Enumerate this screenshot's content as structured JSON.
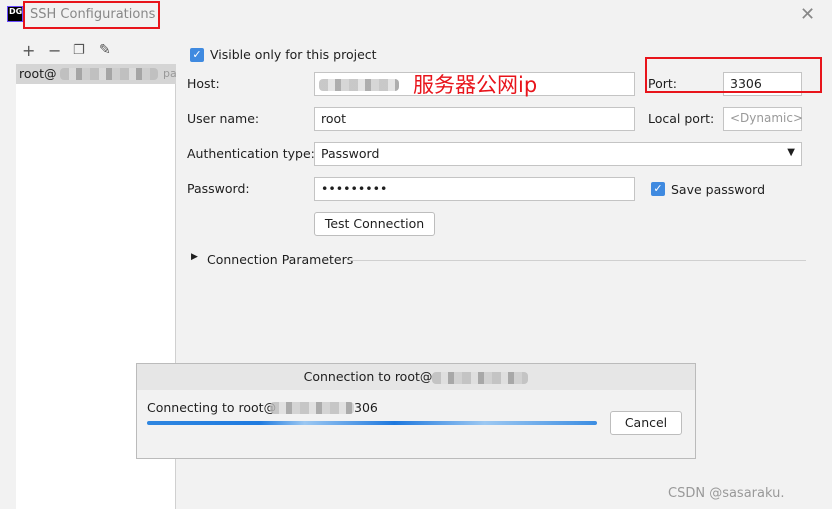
{
  "window": {
    "title": "SSH Configurations",
    "logo": "DG",
    "close_icon": "close-icon"
  },
  "sidebar": {
    "toolbar": [
      "add-icon",
      "remove-icon",
      "copy-icon",
      "edit-icon"
    ],
    "items": [
      {
        "label": "root@",
        "suffix": "pa"
      }
    ]
  },
  "form": {
    "visible_only": {
      "label": "Visible only for this project",
      "checked": true
    },
    "host": {
      "label": "Host:",
      "value": ""
    },
    "annotation": "服务器公网ip",
    "port": {
      "label": "Port:",
      "value": "3306"
    },
    "user": {
      "label": "User name:",
      "value": "root"
    },
    "local_port": {
      "label": "Local port:",
      "placeholder": "<Dynamic>"
    },
    "auth": {
      "label": "Authentication type:",
      "value": "Password"
    },
    "password": {
      "label": "Password:",
      "value": "•••••••••"
    },
    "save_password": {
      "label": "Save password",
      "checked": true
    },
    "test_button": "Test Connection",
    "connection_params": "Connection Parameters"
  },
  "progress_dialog": {
    "title": "Connection to root@",
    "message": "Connecting to root@",
    "message_suffix": "306",
    "progress": "indeterminate",
    "cancel": "Cancel"
  },
  "watermark": "CSDN @sasaraku.",
  "colors": {
    "accent": "#3f8ae0",
    "highlight": "#e8141b"
  }
}
